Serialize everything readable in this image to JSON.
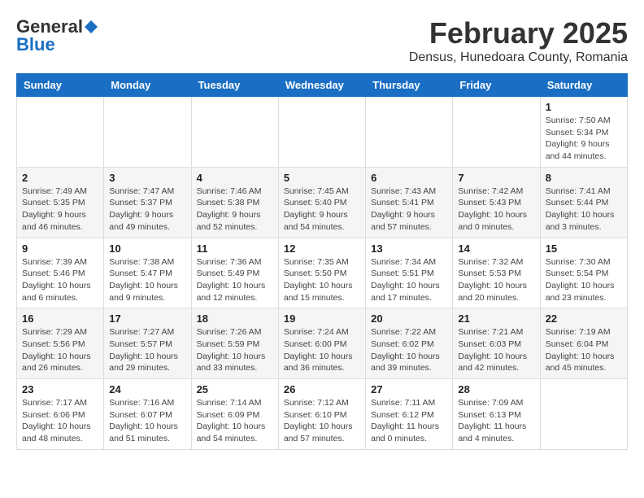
{
  "header": {
    "logo_general": "General",
    "logo_blue": "Blue",
    "month_title": "February 2025",
    "location": "Densus, Hunedoara County, Romania"
  },
  "weekdays": [
    "Sunday",
    "Monday",
    "Tuesday",
    "Wednesday",
    "Thursday",
    "Friday",
    "Saturday"
  ],
  "weeks": [
    [
      {
        "day": "",
        "info": ""
      },
      {
        "day": "",
        "info": ""
      },
      {
        "day": "",
        "info": ""
      },
      {
        "day": "",
        "info": ""
      },
      {
        "day": "",
        "info": ""
      },
      {
        "day": "",
        "info": ""
      },
      {
        "day": "1",
        "info": "Sunrise: 7:50 AM\nSunset: 5:34 PM\nDaylight: 9 hours and 44 minutes."
      }
    ],
    [
      {
        "day": "2",
        "info": "Sunrise: 7:49 AM\nSunset: 5:35 PM\nDaylight: 9 hours and 46 minutes."
      },
      {
        "day": "3",
        "info": "Sunrise: 7:47 AM\nSunset: 5:37 PM\nDaylight: 9 hours and 49 minutes."
      },
      {
        "day": "4",
        "info": "Sunrise: 7:46 AM\nSunset: 5:38 PM\nDaylight: 9 hours and 52 minutes."
      },
      {
        "day": "5",
        "info": "Sunrise: 7:45 AM\nSunset: 5:40 PM\nDaylight: 9 hours and 54 minutes."
      },
      {
        "day": "6",
        "info": "Sunrise: 7:43 AM\nSunset: 5:41 PM\nDaylight: 9 hours and 57 minutes."
      },
      {
        "day": "7",
        "info": "Sunrise: 7:42 AM\nSunset: 5:43 PM\nDaylight: 10 hours and 0 minutes."
      },
      {
        "day": "8",
        "info": "Sunrise: 7:41 AM\nSunset: 5:44 PM\nDaylight: 10 hours and 3 minutes."
      }
    ],
    [
      {
        "day": "9",
        "info": "Sunrise: 7:39 AM\nSunset: 5:46 PM\nDaylight: 10 hours and 6 minutes."
      },
      {
        "day": "10",
        "info": "Sunrise: 7:38 AM\nSunset: 5:47 PM\nDaylight: 10 hours and 9 minutes."
      },
      {
        "day": "11",
        "info": "Sunrise: 7:36 AM\nSunset: 5:49 PM\nDaylight: 10 hours and 12 minutes."
      },
      {
        "day": "12",
        "info": "Sunrise: 7:35 AM\nSunset: 5:50 PM\nDaylight: 10 hours and 15 minutes."
      },
      {
        "day": "13",
        "info": "Sunrise: 7:34 AM\nSunset: 5:51 PM\nDaylight: 10 hours and 17 minutes."
      },
      {
        "day": "14",
        "info": "Sunrise: 7:32 AM\nSunset: 5:53 PM\nDaylight: 10 hours and 20 minutes."
      },
      {
        "day": "15",
        "info": "Sunrise: 7:30 AM\nSunset: 5:54 PM\nDaylight: 10 hours and 23 minutes."
      }
    ],
    [
      {
        "day": "16",
        "info": "Sunrise: 7:29 AM\nSunset: 5:56 PM\nDaylight: 10 hours and 26 minutes."
      },
      {
        "day": "17",
        "info": "Sunrise: 7:27 AM\nSunset: 5:57 PM\nDaylight: 10 hours and 29 minutes."
      },
      {
        "day": "18",
        "info": "Sunrise: 7:26 AM\nSunset: 5:59 PM\nDaylight: 10 hours and 33 minutes."
      },
      {
        "day": "19",
        "info": "Sunrise: 7:24 AM\nSunset: 6:00 PM\nDaylight: 10 hours and 36 minutes."
      },
      {
        "day": "20",
        "info": "Sunrise: 7:22 AM\nSunset: 6:02 PM\nDaylight: 10 hours and 39 minutes."
      },
      {
        "day": "21",
        "info": "Sunrise: 7:21 AM\nSunset: 6:03 PM\nDaylight: 10 hours and 42 minutes."
      },
      {
        "day": "22",
        "info": "Sunrise: 7:19 AM\nSunset: 6:04 PM\nDaylight: 10 hours and 45 minutes."
      }
    ],
    [
      {
        "day": "23",
        "info": "Sunrise: 7:17 AM\nSunset: 6:06 PM\nDaylight: 10 hours and 48 minutes."
      },
      {
        "day": "24",
        "info": "Sunrise: 7:16 AM\nSunset: 6:07 PM\nDaylight: 10 hours and 51 minutes."
      },
      {
        "day": "25",
        "info": "Sunrise: 7:14 AM\nSunset: 6:09 PM\nDaylight: 10 hours and 54 minutes."
      },
      {
        "day": "26",
        "info": "Sunrise: 7:12 AM\nSunset: 6:10 PM\nDaylight: 10 hours and 57 minutes."
      },
      {
        "day": "27",
        "info": "Sunrise: 7:11 AM\nSunset: 6:12 PM\nDaylight: 11 hours and 0 minutes."
      },
      {
        "day": "28",
        "info": "Sunrise: 7:09 AM\nSunset: 6:13 PM\nDaylight: 11 hours and 4 minutes."
      },
      {
        "day": "",
        "info": ""
      }
    ]
  ]
}
